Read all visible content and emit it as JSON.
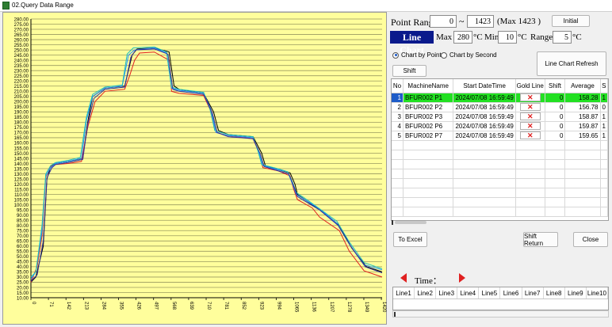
{
  "window": {
    "title": "02.Query Data Range"
  },
  "controls": {
    "point_range_label": "Point Range",
    "range_start": "0",
    "tilde": "~",
    "range_end": "1423",
    "max_note": "(Max 1423 )",
    "initial_button": "Initial",
    "line_chart_tag": "Line Chart",
    "max_label": "Max",
    "max_value": "280",
    "min_label": "Min",
    "min_value": "10",
    "range_label": "Range",
    "range_value": "5",
    "unit": "°C",
    "chart_by_point": "Chart by Point",
    "chart_by_second": "Chart by Second",
    "selected_mode": "point",
    "shift_button": "Shift",
    "refresh_button": "Line Chart Refresh",
    "to_excel_button": "To Excel",
    "shift_return_button": "Shift Return",
    "close_button": "Close",
    "time_label": "Time："
  },
  "grid": {
    "headers": [
      "No",
      "MachineName",
      "Start DateTime",
      "Gold Line",
      "Shift",
      "Average",
      "S"
    ],
    "rows": [
      {
        "no": "1",
        "machine": "BFUR002 P1",
        "start": "2024/07/08 16:59:49",
        "gold": "✕",
        "shift": "0",
        "average": "158.28",
        "s": "1"
      },
      {
        "no": "2",
        "machine": "BFUR002 P2",
        "start": "2024/07/08 16:59:49",
        "gold": "✕",
        "shift": "0",
        "average": "156.78",
        "s": "0"
      },
      {
        "no": "3",
        "machine": "BFUR002 P3",
        "start": "2024/07/08 16:59:49",
        "gold": "✕",
        "shift": "0",
        "average": "158.87",
        "s": "1"
      },
      {
        "no": "4",
        "machine": "BFUR002 P6",
        "start": "2024/07/08 16:59:49",
        "gold": "✕",
        "shift": "0",
        "average": "159.87",
        "s": "1"
      },
      {
        "no": "5",
        "machine": "BFUR002 P7",
        "start": "2024/07/08 16:59:49",
        "gold": "✕",
        "shift": "0",
        "average": "159.65",
        "s": "1"
      }
    ],
    "selected_row": 0
  },
  "lines_table": {
    "headers": [
      "Line1",
      "Line2",
      "Line3",
      "Line4",
      "Line5",
      "Line6",
      "Line7",
      "Line8",
      "Line9",
      "Line10"
    ]
  },
  "colors": {
    "chart_bg": "#fffe9c",
    "selected_row": "#22e022",
    "selected_no": "#1e5cc8",
    "arrow": "#e02020"
  },
  "chart_data": {
    "type": "line",
    "ylim": [
      10,
      280
    ],
    "y_step": 5,
    "xlim": [
      0,
      1423
    ],
    "x_ticks": [
      "0",
      "71",
      "142",
      "213",
      "284",
      "355",
      "426",
      "497",
      "568",
      "639",
      "710",
      "781",
      "852",
      "923",
      "994",
      "1065",
      "1136",
      "1207",
      "1278",
      "1349",
      "1420"
    ],
    "y_ticks_major": [
      "10.00",
      "20.00",
      "30.00",
      "40.00",
      "50.00",
      "60.00",
      "70.00",
      "80.00",
      "90.00",
      "100.00",
      "110.00",
      "120.00",
      "130.00",
      "140.00",
      "150.00",
      "160.00",
      "170.00",
      "180.00",
      "190.00",
      "200.00",
      "210.00",
      "220.00",
      "230.00",
      "240.00",
      "250.00",
      "260.00",
      "270.00",
      "280.00"
    ],
    "y_ticks_minor": [
      "15.00",
      "25.00",
      "35.00",
      "45.00",
      "55.00",
      "65.00",
      "75.00",
      "85.00",
      "95.00",
      "105.00",
      "115.00",
      "125.00",
      "135.00",
      "145.00",
      "155.00",
      "165.00",
      "175.00",
      "185.00",
      "195.00",
      "205.00",
      "215.00",
      "225.00",
      "235.00",
      "245.00",
      "255.00",
      "265.00",
      "275.00"
    ],
    "series": [
      {
        "color": "#000000",
        "x": [
          0,
          20,
          50,
          65,
          80,
          100,
          150,
          210,
          230,
          250,
          300,
          380,
          410,
          430,
          500,
          560,
          580,
          600,
          700,
          740,
          760,
          800,
          900,
          935,
          950,
          1000,
          1050,
          1070,
          1080,
          1140,
          1170,
          1250,
          1300,
          1360,
          1423
        ],
        "y": [
          25,
          30,
          60,
          125,
          137,
          140,
          142,
          145,
          180,
          205,
          213,
          215,
          245,
          251,
          252,
          248,
          215,
          212,
          208,
          190,
          172,
          168,
          166,
          150,
          138,
          134,
          131,
          120,
          110,
          100,
          96,
          80,
          58,
          40,
          35
        ]
      },
      {
        "color": "#e02020",
        "x": [
          0,
          25,
          45,
          60,
          80,
          100,
          150,
          205,
          230,
          260,
          300,
          380,
          400,
          420,
          440,
          500,
          560,
          570,
          600,
          700,
          730,
          750,
          800,
          900,
          925,
          940,
          1000,
          1050,
          1065,
          1080,
          1140,
          1170,
          1250,
          1290,
          1350,
          1423
        ],
        "y": [
          25,
          40,
          70,
          127,
          137,
          139,
          140,
          142,
          175,
          200,
          210,
          212,
          225,
          240,
          247,
          248,
          240,
          210,
          208,
          206,
          190,
          170,
          167,
          164,
          150,
          136,
          133,
          128,
          115,
          105,
          97,
          88,
          75,
          55,
          36,
          30
        ]
      },
      {
        "color": "#1e90ff",
        "x": [
          0,
          20,
          45,
          60,
          80,
          100,
          150,
          205,
          225,
          250,
          300,
          370,
          395,
          420,
          500,
          550,
          570,
          600,
          700,
          730,
          750,
          800,
          900,
          925,
          940,
          1000,
          1040,
          1060,
          1075,
          1130,
          1170,
          1240,
          1290,
          1350,
          1423
        ],
        "y": [
          28,
          35,
          75,
          128,
          136,
          140,
          142,
          145,
          182,
          205,
          213,
          215,
          245,
          250,
          252,
          247,
          213,
          211,
          208,
          192,
          170,
          167,
          165,
          150,
          138,
          134,
          132,
          120,
          110,
          102,
          96,
          82,
          62,
          42,
          37
        ]
      },
      {
        "color": "#20c0c0",
        "x": [
          0,
          20,
          45,
          60,
          80,
          100,
          150,
          200,
          225,
          250,
          300,
          370,
          390,
          415,
          500,
          550,
          570,
          600,
          700,
          725,
          745,
          800,
          900,
          920,
          935,
          1000,
          1040,
          1060,
          1075,
          1130,
          1165,
          1240,
          1290,
          1350,
          1423
        ],
        "y": [
          30,
          35,
          80,
          130,
          138,
          141,
          143,
          146,
          185,
          207,
          214,
          216,
          246,
          252,
          253,
          248,
          214,
          212,
          209,
          193,
          172,
          168,
          166,
          152,
          139,
          135,
          132,
          122,
          112,
          103,
          97,
          84,
          64,
          44,
          38
        ]
      },
      {
        "color": "#3030a0",
        "x": [
          0,
          25,
          50,
          65,
          85,
          100,
          150,
          210,
          230,
          255,
          300,
          380,
          405,
          425,
          500,
          555,
          575,
          600,
          700,
          735,
          755,
          800,
          900,
          930,
          945,
          1000,
          1045,
          1065,
          1080,
          1135,
          1170,
          1245,
          1295,
          1355,
          1423
        ],
        "y": [
          26,
          32,
          65,
          126,
          136,
          139,
          141,
          144,
          178,
          203,
          212,
          214,
          243,
          250,
          251,
          246,
          212,
          210,
          207,
          189,
          170,
          166,
          164,
          149,
          137,
          133,
          130,
          118,
          108,
          100,
          95,
          80,
          60,
          40,
          34
        ]
      }
    ]
  }
}
